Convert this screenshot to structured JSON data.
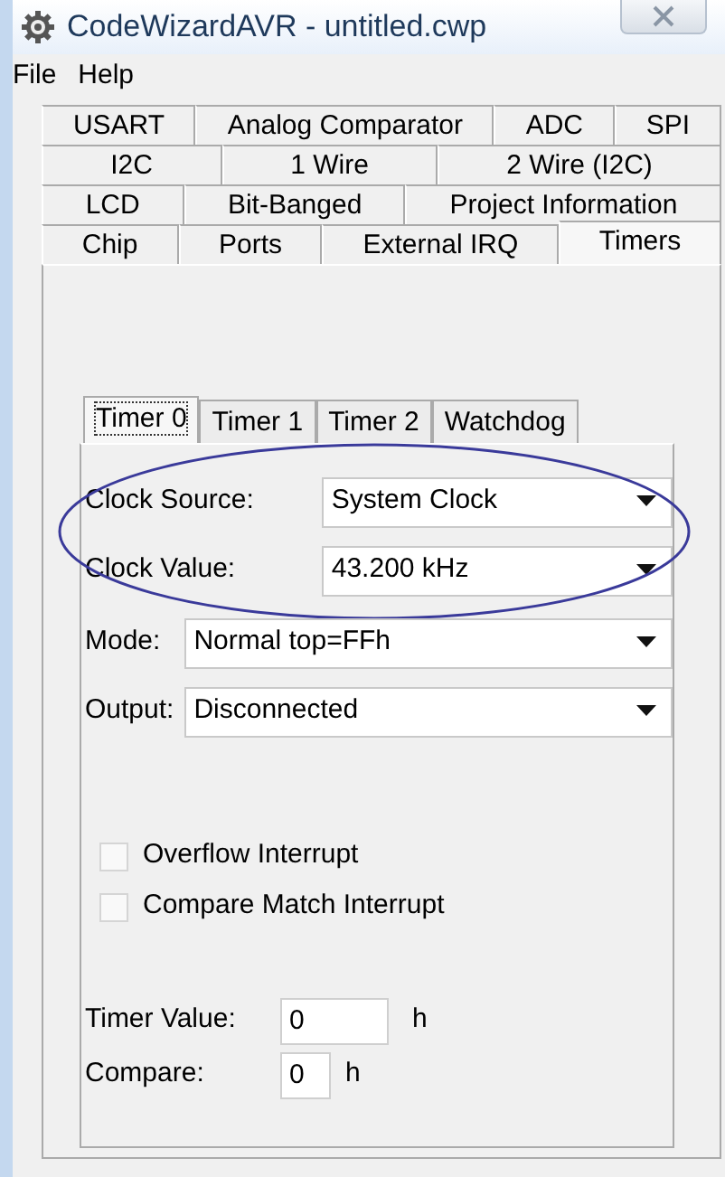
{
  "window": {
    "title": "CodeWizardAVR - untitled.cwp"
  },
  "menu": [
    "File",
    "Help"
  ],
  "tab_rows": [
    [
      {
        "label": "USART",
        "selected": false
      },
      {
        "label": "Analog Comparator",
        "selected": false
      },
      {
        "label": "ADC",
        "selected": false
      },
      {
        "label": "SPI",
        "selected": false
      }
    ],
    [
      {
        "label": "I2C",
        "selected": false
      },
      {
        "label": "1 Wire",
        "selected": false
      },
      {
        "label": "2 Wire (I2C)",
        "selected": false
      }
    ],
    [
      {
        "label": "LCD",
        "selected": false
      },
      {
        "label": "Bit-Banged",
        "selected": false
      },
      {
        "label": "Project Information",
        "selected": false
      }
    ],
    [
      {
        "label": "Chip",
        "selected": false
      },
      {
        "label": "Ports",
        "selected": false
      },
      {
        "label": "External IRQ",
        "selected": false
      },
      {
        "label": "Timers",
        "selected": true
      }
    ]
  ],
  "timer_tabs": [
    {
      "label": "Timer 0",
      "selected": true
    },
    {
      "label": "Timer 1",
      "selected": false
    },
    {
      "label": "Timer 2",
      "selected": false
    },
    {
      "label": "Watchdog",
      "selected": false
    }
  ],
  "fields": [
    {
      "label": "Clock Source:",
      "value": "System Clock",
      "circled": true
    },
    {
      "label": "Clock Value:",
      "value": "43.200 kHz",
      "circled": true
    },
    {
      "label": "Mode:",
      "value": "Normal top=FFh",
      "circled": false
    },
    {
      "label": "Output:",
      "value": "Disconnected",
      "circled": false
    }
  ],
  "checkboxes": [
    {
      "label": "Overflow Interrupt",
      "checked": false
    },
    {
      "label": "Compare Match Interrupt",
      "checked": false
    }
  ],
  "values": [
    {
      "label": "Timer Value:",
      "value": "0",
      "unit": "h"
    },
    {
      "label": "Compare:",
      "value": "0",
      "unit": "h"
    }
  ]
}
